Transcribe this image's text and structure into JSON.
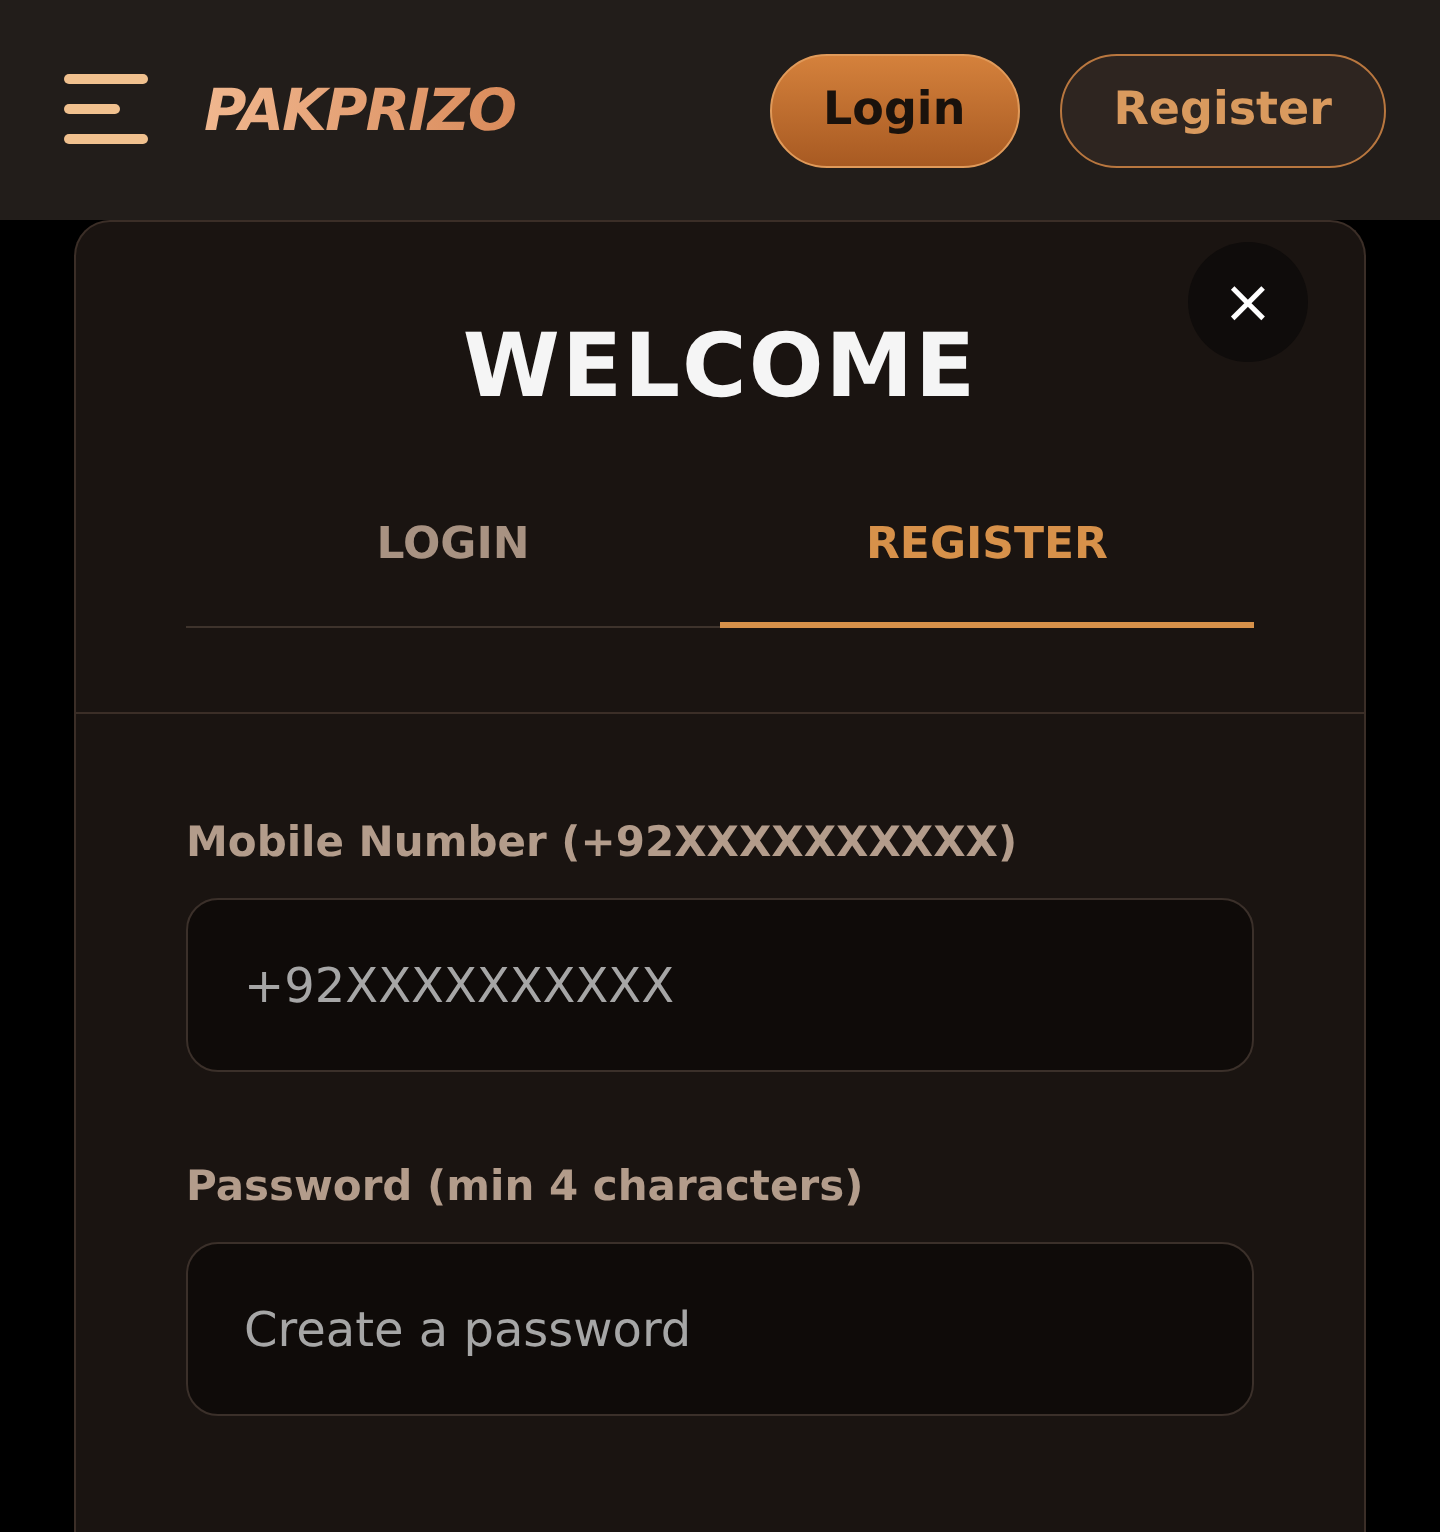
{
  "header": {
    "logo": "PAKPRIZO",
    "buttons": [
      {
        "label": "Login",
        "kind": "primary"
      },
      {
        "label": "Register",
        "kind": "outline"
      }
    ]
  },
  "modal": {
    "close": "×",
    "title": "WELCOME",
    "tabs": [
      {
        "label": "LOGIN",
        "selected": false
      },
      {
        "label": "REGISTER",
        "selected": true
      }
    ],
    "fields": [
      {
        "label": "Mobile Number (+92XXXXXXXXXX)",
        "placeholder": "+92XXXXXXXXXX"
      },
      {
        "label": "Password (min 4 characters)",
        "placeholder": "Create a password"
      }
    ]
  }
}
